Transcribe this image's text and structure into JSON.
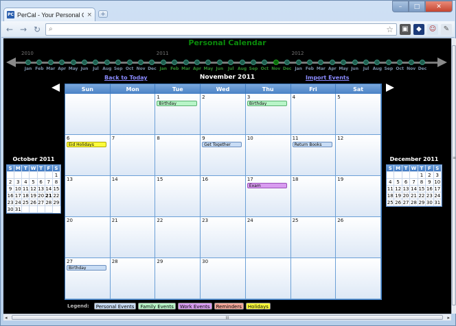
{
  "browser": {
    "tab_title": "PerCal - Your Personal Cale",
    "tab_favicon": "PC",
    "tab_close": "×",
    "new_tab": "+",
    "controls": {
      "minimize": "–",
      "maximize": "□",
      "close": "✕"
    },
    "url": ""
  },
  "app": {
    "title": "Personal Calendar",
    "nav": {
      "back_to_today": "Back to Today",
      "month_title": "November 2011",
      "import_events": "Import Events"
    }
  },
  "timeline": {
    "years": [
      "2010",
      "2011",
      "2012"
    ],
    "months": [
      "Jan",
      "Feb",
      "Mar",
      "Apr",
      "May",
      "Jun",
      "Jul",
      "Aug",
      "Sep",
      "Oct",
      "Nov",
      "Dec",
      "Jan",
      "Feb",
      "Mar",
      "Apr",
      "May",
      "Jun",
      "Jul",
      "Aug",
      "Sep",
      "Oct",
      "Nov",
      "Dec",
      "Jan",
      "Feb",
      "Mar",
      "Apr",
      "May",
      "Jun",
      "Jul",
      "Aug",
      "Sep",
      "Oct",
      "Nov",
      "Dec"
    ],
    "current_index": 22
  },
  "calendar": {
    "weekdays": [
      "Sun",
      "Mon",
      "Tue",
      "Wed",
      "Thu",
      "Fri",
      "Sat"
    ],
    "cells": [
      {
        "num": "",
        "events": []
      },
      {
        "num": "",
        "events": []
      },
      {
        "num": "1",
        "events": [
          {
            "label": "Birthday",
            "type": "family"
          }
        ]
      },
      {
        "num": "2",
        "events": []
      },
      {
        "num": "3",
        "events": [
          {
            "label": "Birthday",
            "type": "family"
          }
        ]
      },
      {
        "num": "4",
        "events": []
      },
      {
        "num": "5",
        "events": []
      },
      {
        "num": "6",
        "events": [
          {
            "label": "Eid Holidays",
            "type": "holiday"
          }
        ]
      },
      {
        "num": "7",
        "events": []
      },
      {
        "num": "8",
        "events": []
      },
      {
        "num": "9",
        "events": [
          {
            "label": "Get Together",
            "type": "personal"
          }
        ]
      },
      {
        "num": "10",
        "events": []
      },
      {
        "num": "11",
        "events": [
          {
            "label": "Return Books",
            "type": "personal"
          }
        ]
      },
      {
        "num": "12",
        "events": []
      },
      {
        "num": "13",
        "events": []
      },
      {
        "num": "14",
        "events": []
      },
      {
        "num": "15",
        "events": []
      },
      {
        "num": "16",
        "events": []
      },
      {
        "num": "17",
        "events": [
          {
            "label": "Exam",
            "type": "work"
          }
        ]
      },
      {
        "num": "18",
        "events": []
      },
      {
        "num": "19",
        "events": []
      },
      {
        "num": "20",
        "events": []
      },
      {
        "num": "21",
        "events": []
      },
      {
        "num": "22",
        "events": []
      },
      {
        "num": "23",
        "events": []
      },
      {
        "num": "24",
        "events": []
      },
      {
        "num": "25",
        "events": []
      },
      {
        "num": "26",
        "events": []
      },
      {
        "num": "27",
        "events": [
          {
            "label": "Birthday",
            "type": "personal"
          }
        ]
      },
      {
        "num": "28",
        "events": []
      },
      {
        "num": "29",
        "events": []
      },
      {
        "num": "30",
        "events": []
      },
      {
        "num": "",
        "events": []
      },
      {
        "num": "",
        "events": []
      },
      {
        "num": "",
        "events": []
      }
    ]
  },
  "mini_prev": {
    "title": "October 2011",
    "heads": [
      "S",
      "M",
      "T",
      "W",
      "T",
      "F",
      "S"
    ],
    "days": [
      "",
      "",
      "",
      "",
      "",
      "",
      "1",
      "2",
      "3",
      "4",
      "5",
      "6",
      "7",
      "8",
      "9",
      "10",
      "11",
      "12",
      "13",
      "14",
      "15",
      "16",
      "17",
      "18",
      "19",
      "20",
      "21",
      "22",
      "23",
      "24",
      "25",
      "26",
      "27",
      "28",
      "29",
      "30",
      "31",
      "",
      "",
      "",
      ""
    ],
    "bold_day": "21"
  },
  "mini_next": {
    "title": "December 2011",
    "heads": [
      "S",
      "M",
      "T",
      "W",
      "T",
      "F",
      "S"
    ],
    "days": [
      "",
      "",
      "",
      "",
      "1",
      "2",
      "3",
      "4",
      "5",
      "6",
      "7",
      "8",
      "9",
      "10",
      "11",
      "12",
      "13",
      "14",
      "15",
      "16",
      "17",
      "18",
      "19",
      "20",
      "21",
      "22",
      "23",
      "24",
      "25",
      "26",
      "27",
      "28",
      "29",
      "30",
      "31"
    ]
  },
  "legend": {
    "label": "Legend:",
    "items": [
      {
        "label": "Personal Events",
        "type": "personal"
      },
      {
        "label": "Family Events",
        "type": "family"
      },
      {
        "label": "Work Events",
        "type": "work"
      },
      {
        "label": "Reminders",
        "type": "reminders"
      },
      {
        "label": "Holidays",
        "type": "holidays"
      }
    ]
  },
  "scrollbar": {
    "left": "◂",
    "right": "▸",
    "grip": "III"
  }
}
